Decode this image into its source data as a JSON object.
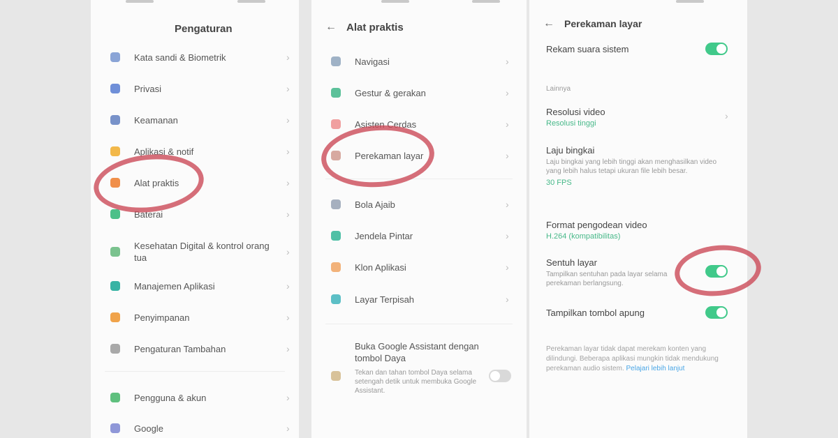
{
  "panel1": {
    "title": "Pengaturan",
    "items": [
      {
        "label": "Kata sandi & Biometrik",
        "icon": "fingerprint-icon",
        "color": "#8aa4d6"
      },
      {
        "label": "Privasi",
        "icon": "privacy-icon",
        "color": "#6f8fd8"
      },
      {
        "label": "Keamanan",
        "icon": "shield-icon",
        "color": "#7892c9"
      },
      {
        "label": "Aplikasi & notif",
        "icon": "apps-icon",
        "color": "#f2b84a"
      },
      {
        "label": "Alat praktis",
        "icon": "tools-icon",
        "color": "#f08f4a"
      },
      {
        "label": "Baterai",
        "icon": "battery-icon",
        "color": "#4cc089"
      },
      {
        "label": "Kesehatan Digital & kontrol orang tua",
        "icon": "hourglass-icon",
        "color": "#7ac28e"
      },
      {
        "label": "Manajemen Aplikasi",
        "icon": "app-grid-icon",
        "color": "#38b3a4"
      },
      {
        "label": "Penyimpanan",
        "icon": "storage-icon",
        "color": "#f0a34a"
      },
      {
        "label": "Pengaturan Tambahan",
        "icon": "gear-icon",
        "color": "#a9a9a9"
      },
      {
        "label": "Pengguna & akun",
        "icon": "user-icon",
        "color": "#5fc07e"
      },
      {
        "label": "Google",
        "icon": "google-icon",
        "color": "#8f97d8"
      }
    ]
  },
  "panel2": {
    "title": "Alat praktis",
    "back": "←",
    "items": [
      {
        "label": "Navigasi",
        "icon": "navigation-icon",
        "color": "#9fb2c6"
      },
      {
        "label": "Gestur & gerakan",
        "icon": "gesture-icon",
        "color": "#5cc19a"
      },
      {
        "label": "Asisten Cerdas",
        "icon": "assistant-icon",
        "color": "#f0a0a0"
      },
      {
        "label": "Perekaman layar",
        "icon": "record-icon",
        "color": "#d7a9a0"
      },
      {
        "label": "Bola Ajaib",
        "icon": "ball-icon",
        "color": "#a6b0bf"
      },
      {
        "label": "Jendela Pintar",
        "icon": "window-icon",
        "color": "#4fc0a6"
      },
      {
        "label": "Klon Aplikasi",
        "icon": "clone-icon",
        "color": "#f2b27a"
      },
      {
        "label": "Layar Terpisah",
        "icon": "split-icon",
        "color": "#5cbfc6"
      }
    ],
    "bottom_item": {
      "label": "Buka Google Assistant dengan tombol Daya",
      "desc": "Tekan dan tahan tombol Daya selama setengah detik untuk membuka Google Assistant.",
      "icon": "mic-icon",
      "color": "#d8c29a"
    }
  },
  "panel3": {
    "title": "Perekaman layar",
    "back": "←",
    "toggle1_label": "Rekam suara sistem",
    "section": "Lainnya",
    "res_title": "Resolusi video",
    "res_value": "Resolusi tinggi",
    "fps_title": "Laju bingkai",
    "fps_desc": "Laju bingkai yang lebih tinggi akan menghasilkan video yang lebih halus tetapi ukuran file lebih besar.",
    "fps_value": "30 FPS",
    "format_title": "Format pengodean video",
    "format_value": "H.264 (kompatibilitas)",
    "touch_title": "Sentuh layar",
    "touch_desc": "Tampilkan sentuhan pada layar selama perekaman berlangsung.",
    "float_title": "Tampilkan tombol apung",
    "footnote": "Perekaman layar tidak dapat merekam konten yang dilindungi. Beberapa aplikasi mungkin tidak mendukung perekaman audio sistem.",
    "footnote_link": "Pelajari lebih lanjut",
    "accent": "#41c98a"
  }
}
